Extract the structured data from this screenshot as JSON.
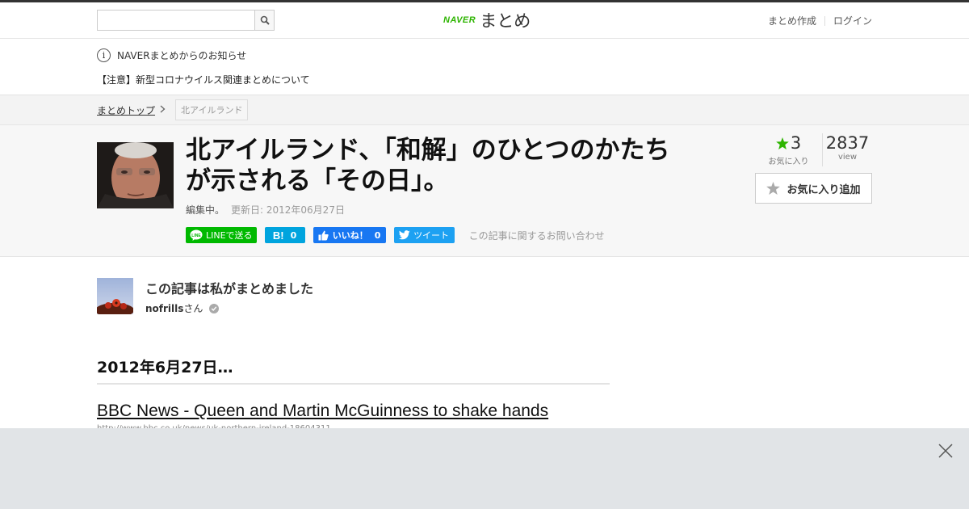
{
  "header": {
    "search_placeholder": "",
    "logo_naver": "NAVER",
    "logo_matome": "まとめ",
    "nav": {
      "create": "まとめ作成",
      "login": "ログイン"
    }
  },
  "notice": {
    "info_glyph": "i",
    "heading": "NAVERまとめからのお知らせ",
    "link": "【注意】新型コロナウイルス関連まとめについて"
  },
  "breadcrumb": {
    "home": "まとめトップ",
    "tag": "北アイルランド"
  },
  "article": {
    "title": "北アイルランド、「和解」のひとつのかたちが示される「その日」。",
    "status": "編集中。",
    "updated": "更新日: 2012年06月27日",
    "favorites": "3",
    "favorites_label": "お気に入り",
    "views": "2837",
    "views_label": "view",
    "fav_button": "お気に入り追加",
    "contact": "この記事に関するお問い合わせ"
  },
  "share": {
    "line": "LINEで送る",
    "hatena_icon": "B!",
    "hatena_count": "0",
    "facebook": "いいね！",
    "facebook_count": "0",
    "twitter": "ツイート"
  },
  "author": {
    "heading": "この記事は私がまとめました",
    "name": "nofrills",
    "suffix": "さん"
  },
  "content": {
    "section_title": "2012年6月27日…",
    "link_title": "BBC News - Queen and Martin McGuinness to shake hands",
    "link_url": "http://www.bbc.co.uk/news/uk-northern-ireland-18604311"
  },
  "colors": {
    "naver_green": "#2db400",
    "line_green": "#00b900",
    "hatena_blue": "#00a4de",
    "facebook_blue": "#1877f2",
    "twitter_blue": "#1da1f2",
    "overlay_gray": "#e1e4e7"
  },
  "icons": [
    "search-icon",
    "info-icon",
    "chevron-right-icon",
    "star-icon",
    "line-icon",
    "facebook-thumb-icon",
    "twitter-bird-icon",
    "verified-icon",
    "close-icon"
  ]
}
